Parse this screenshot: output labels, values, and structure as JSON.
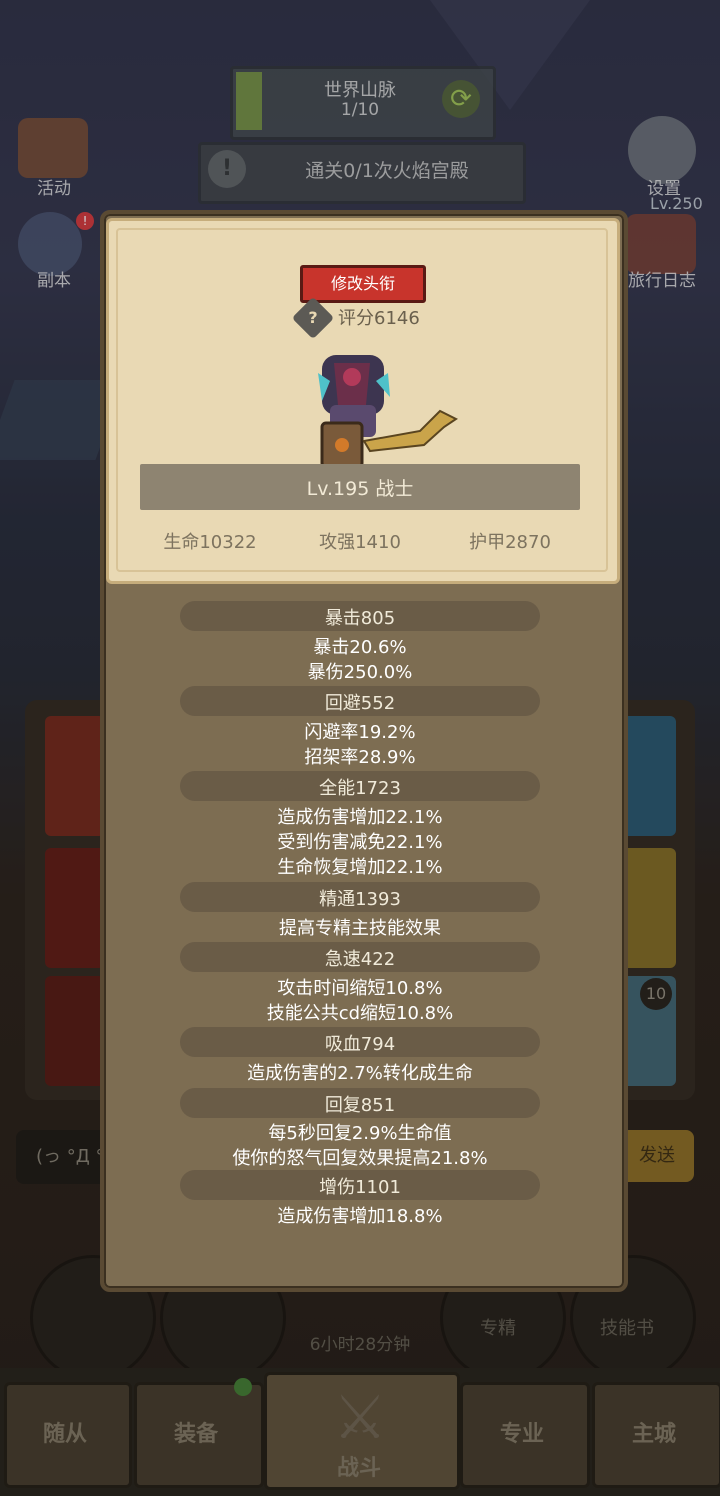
{
  "hud": {
    "zone_name": "世界山脉",
    "zone_progress": "1/10",
    "quest": "通关0/1次火焰宫殿",
    "left_icons": [
      {
        "label": "活动"
      },
      {
        "label": "副本"
      }
    ],
    "right_icons": [
      {
        "label": "设置"
      },
      {
        "label": "旅行日志"
      }
    ],
    "level_badge": "Lv.250"
  },
  "panel": {
    "rename_button": "修改头衔",
    "score": "评分6146",
    "character": "Lv.195 战士",
    "base_stats": {
      "hp": "生命10322",
      "atk": "攻强1410",
      "armor": "护甲2870"
    },
    "stats": [
      {
        "header": "暴击805",
        "lines": [
          "暴击20.6%",
          "暴伤250.0%"
        ]
      },
      {
        "header": "回避552",
        "lines": [
          "闪避率19.2%",
          "招架率28.9%"
        ]
      },
      {
        "header": "全能1723",
        "lines": [
          "造成伤害增加22.1%",
          "受到伤害减免22.1%",
          "生命恢复增加22.1%"
        ]
      },
      {
        "header": "精通1393",
        "lines": [
          "提高专精主技能效果"
        ]
      },
      {
        "header": "急速422",
        "lines": [
          "攻击时间缩短10.8%",
          "技能公共cd缩短10.8%"
        ]
      },
      {
        "header": "吸血794",
        "lines": [
          "造成伤害的2.7%转化成生命"
        ]
      },
      {
        "header": "回复851",
        "lines": [
          "每5秒回复2.9%生命值",
          "使你的怒气回复效果提高21.8%"
        ]
      },
      {
        "header": "增伤1101",
        "lines": [
          "造成伤害增加18.8%"
        ]
      }
    ]
  },
  "behind": {
    "chat_partial": "(っ °Д °",
    "send_partial": "发送",
    "timer": "6小时28分钟",
    "skill_labels": [
      "专精",
      "技能书"
    ],
    "badge_count": "10"
  },
  "nav": {
    "items": [
      "随从",
      "装备",
      "战斗",
      "专业",
      "主城"
    ]
  }
}
